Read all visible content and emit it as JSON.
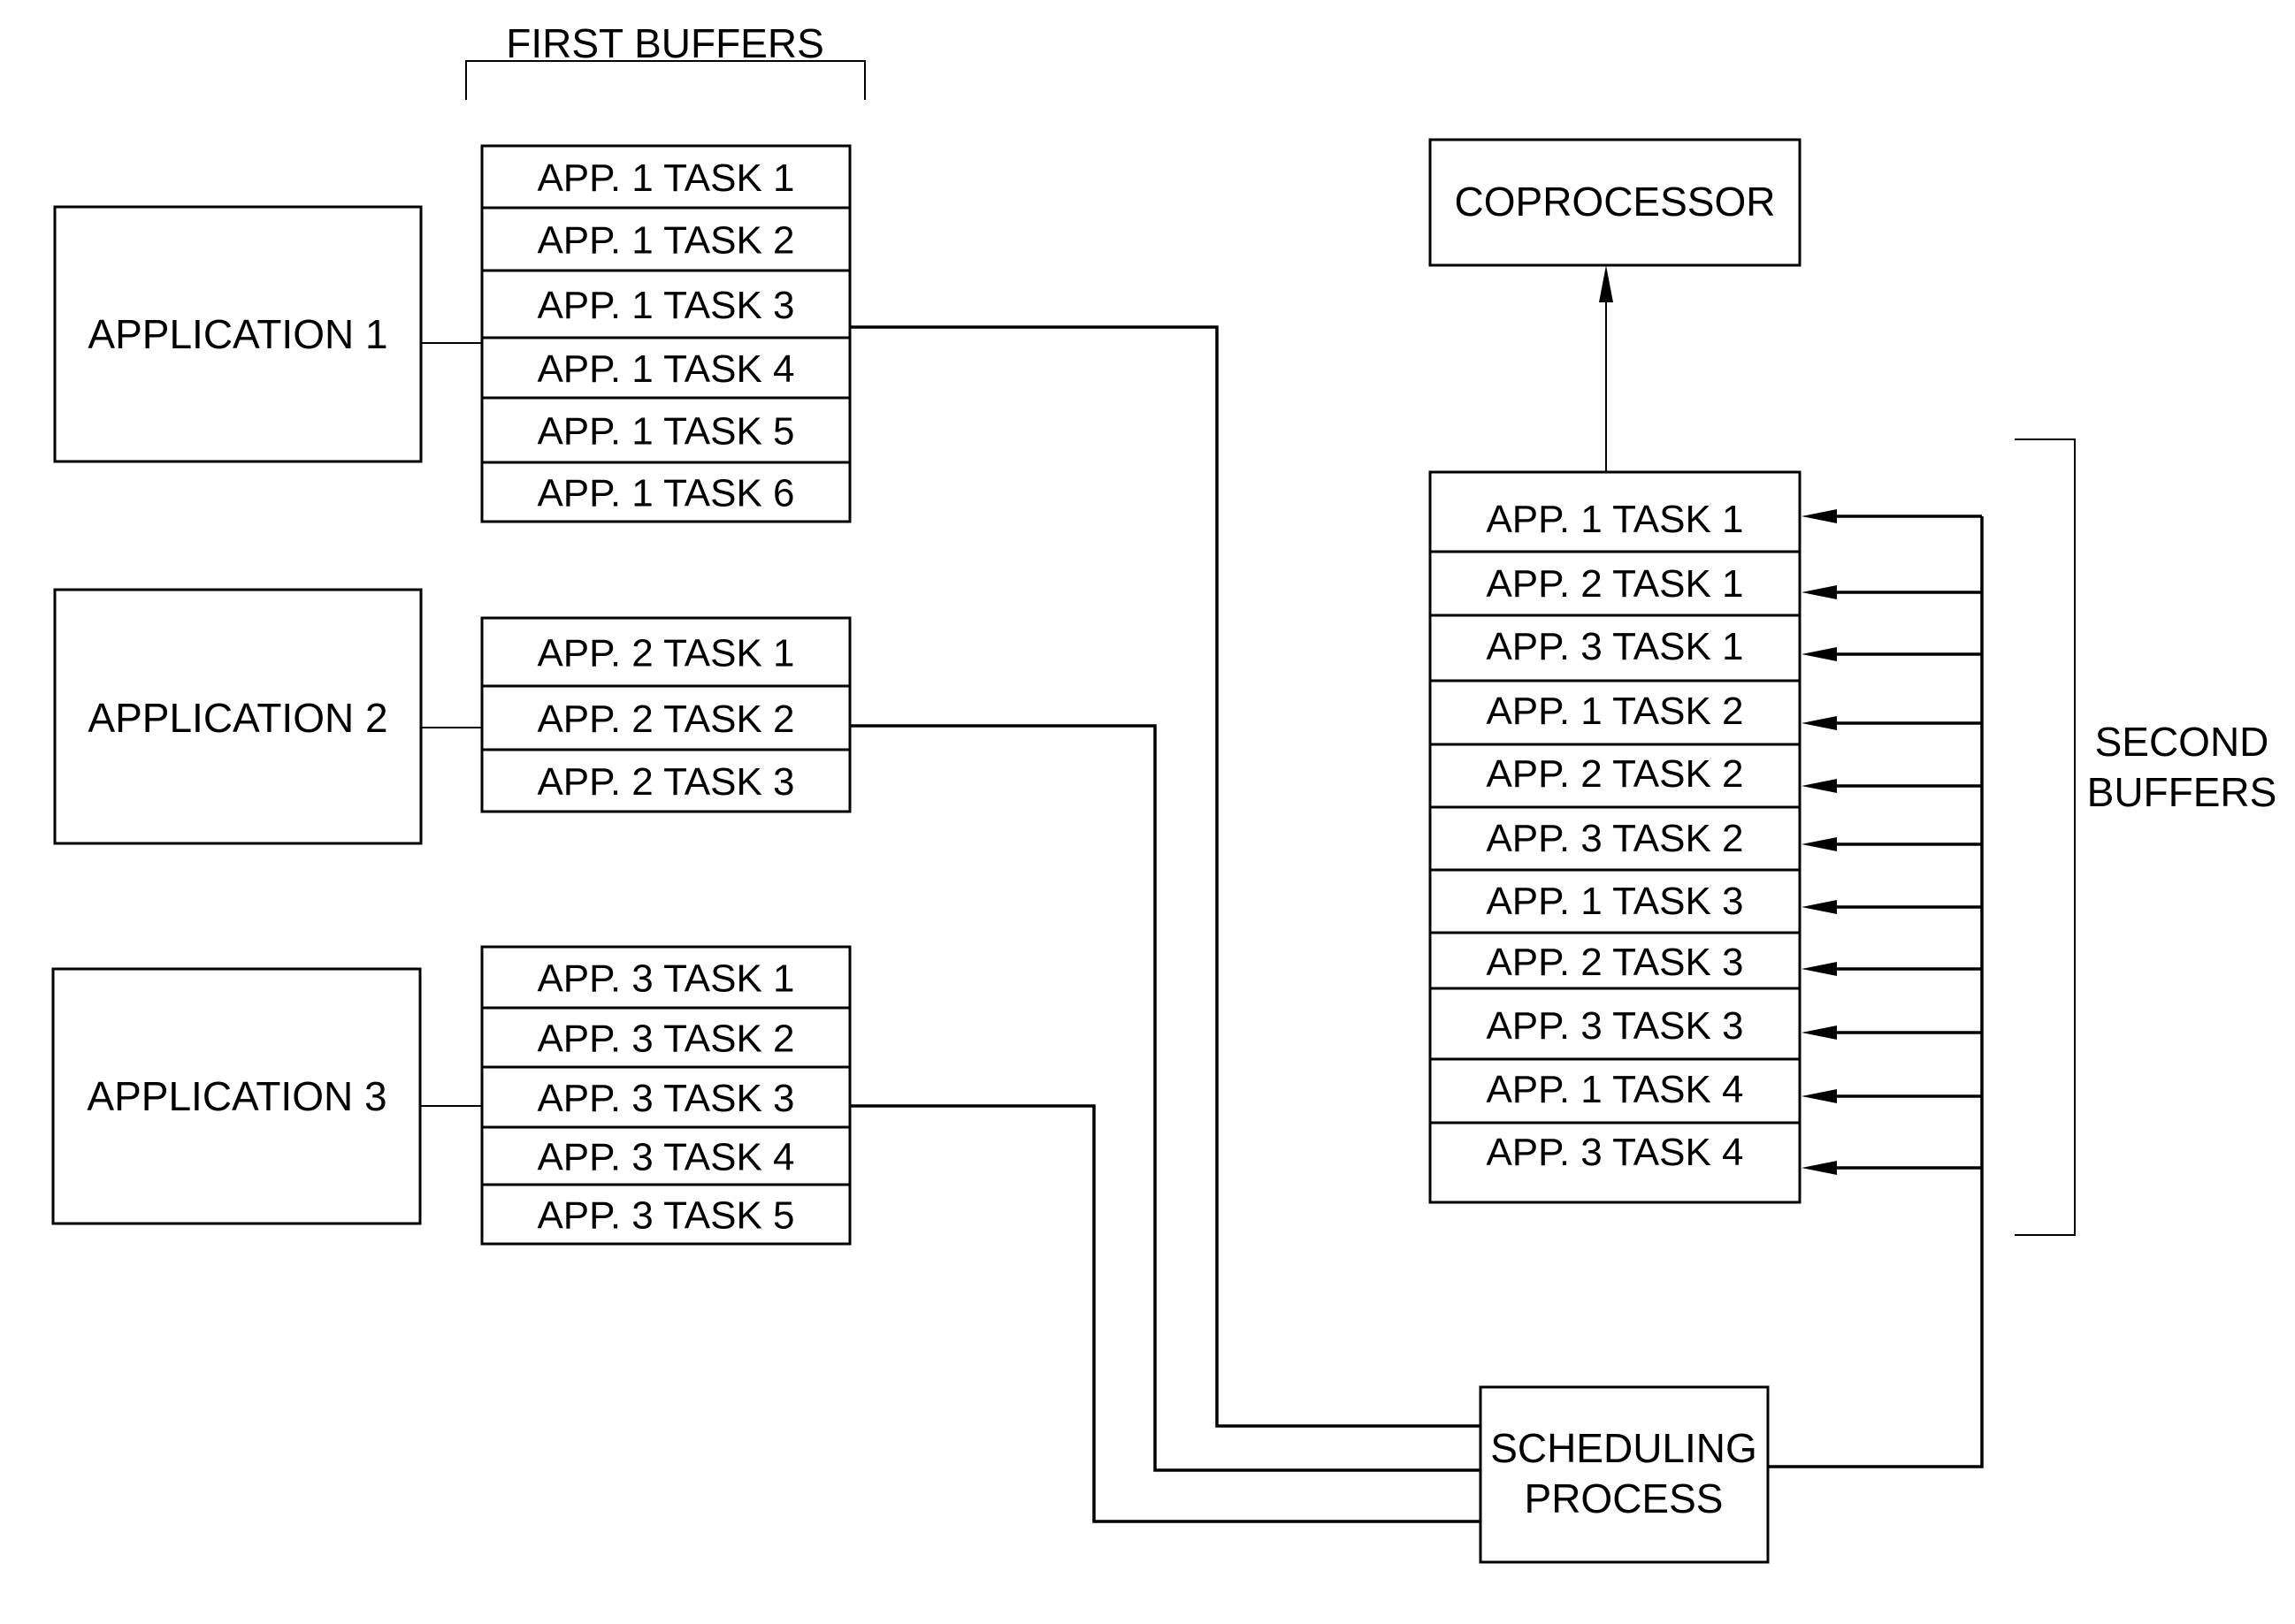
{
  "diagram": {
    "first_buffers_label": "FIRST BUFFERS",
    "second_buffers_label": [
      "SECOND",
      "BUFFERS"
    ],
    "applications": [
      {
        "label": "APPLICATION 1",
        "tasks": [
          "APP. 1 TASK 1",
          "APP. 1 TASK 2",
          "APP. 1 TASK 3",
          "APP. 1 TASK 4",
          "APP. 1 TASK 5",
          "APP. 1 TASK 6"
        ]
      },
      {
        "label": "APPLICATION 2",
        "tasks": [
          "APP. 2 TASK 1",
          "APP. 2 TASK 2",
          "APP. 2 TASK 3"
        ]
      },
      {
        "label": "APPLICATION 3",
        "tasks": [
          "APP. 3 TASK 1",
          "APP. 3 TASK 2",
          "APP. 3 TASK 3",
          "APP. 3 TASK 4",
          "APP. 3 TASK 5"
        ]
      }
    ],
    "scheduler_label": [
      "SCHEDULING",
      "PROCESS"
    ],
    "coprocessor_label": "COPROCESSOR",
    "second_buffers": [
      "APP. 1 TASK 1",
      "APP. 2 TASK 1",
      "APP. 3 TASK 1",
      "APP. 1 TASK 2",
      "APP. 2 TASK 2",
      "APP. 3 TASK 2",
      "APP. 1 TASK 3",
      "APP. 2 TASK 3",
      "APP. 3 TASK 3",
      "APP. 1 TASK 4",
      "APP. 3 TASK 4"
    ],
    "connections": [
      {
        "from": "APP. 1 TASK 3",
        "to": "SCHEDULING PROCESS"
      },
      {
        "from": "APP. 2 TASK 2",
        "to": "SCHEDULING PROCESS"
      },
      {
        "from": "APP. 3 TASK 3",
        "to": "SCHEDULING PROCESS"
      },
      {
        "from": "SCHEDULING PROCESS",
        "to": "SECOND BUFFERS"
      },
      {
        "from": "SECOND BUFFERS",
        "to": "COPROCESSOR"
      }
    ],
    "colors": {
      "ink": "#000000",
      "background": "#ffffff"
    }
  }
}
